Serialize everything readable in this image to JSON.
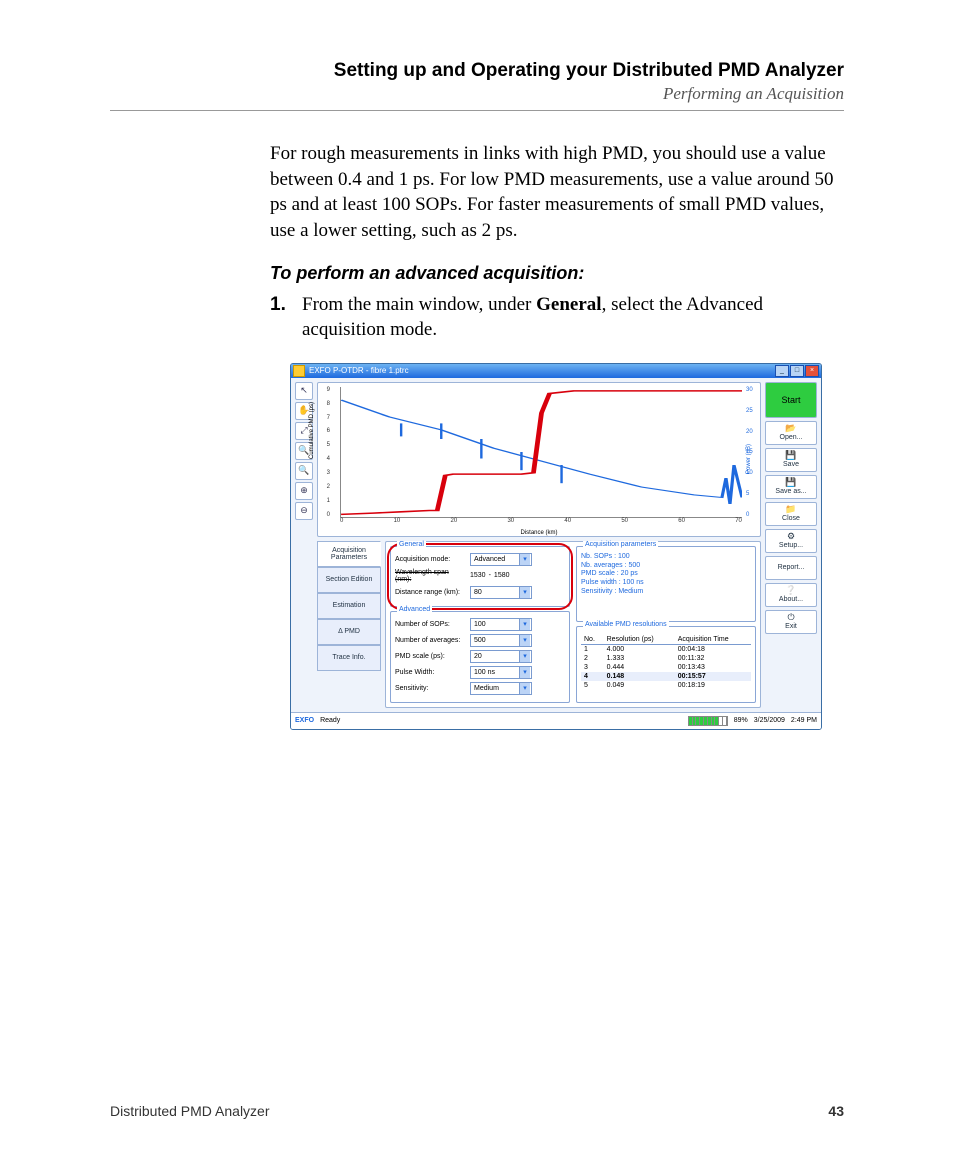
{
  "chapter": "Setting up and Operating your Distributed PMD Analyzer",
  "section": "Performing an Acquisition",
  "para1": "For rough measurements in links with high PMD, you should use a value between 0.4 and 1 ps. For low PMD measurements, use a value around 50 ps and at least 100 SOPs. For faster measurements of small PMD values, use a lower setting, such as 2 ps.",
  "task_head": "To perform an advanced acquisition:",
  "step1_num": "1.",
  "step1_a": "From the main window, under ",
  "step1_b": "General",
  "step1_c": ", select the Advanced acquisition mode.",
  "footer_left": "Distributed PMD Analyzer",
  "footer_right": "43",
  "app": {
    "title": "EXFO P-OTDR - fibre 1.ptrc",
    "tools": [
      "↖",
      "✋",
      "⤢",
      "🔍",
      "🔍",
      "⊕",
      "⊖"
    ],
    "right_buttons": {
      "start": "Start",
      "open": "Open...",
      "save": "Save",
      "saveas": "Save as...",
      "close": "Close",
      "setup": "Setup...",
      "report": "Report...",
      "about": "About...",
      "exit": "Exit"
    },
    "tabs": [
      "Acquisition Parameters",
      "Section Edition",
      "Estimation",
      "Δ PMD",
      "Trace Info."
    ],
    "general": {
      "legend": "General",
      "mode_label": "Acquisition mode:",
      "mode_value": "Advanced",
      "wave_label": "Wavelength span (nm):",
      "wave_from": "1530",
      "wave_to": "1580",
      "range_label": "Distance range (km):",
      "range_value": "80"
    },
    "advanced": {
      "legend": "Advanced",
      "sops_label": "Number of SOPs:",
      "sops_value": "100",
      "avg_label": "Number of averages:",
      "avg_value": "500",
      "scale_label": "PMD scale (ps):",
      "scale_value": "20",
      "pulse_label": "Pulse Width:",
      "pulse_value": "100 ns",
      "sens_label": "Sensitivity:",
      "sens_value": "Medium"
    },
    "acq_params": {
      "legend": "Acquisition parameters",
      "l1": "Nb. SOPs : 100",
      "l2": "Nb. averages : 500",
      "l3": "PMD scale : 20 ps",
      "l4": "Pulse width : 100 ns",
      "l5": "Sensitivity : Medium"
    },
    "resolutions": {
      "legend": "Available PMD resolutions",
      "headers": [
        "No.",
        "Resolution (ps)",
        "Acquisition Time"
      ],
      "rows": [
        {
          "n": "1",
          "r": "4.000",
          "t": "00:04:18"
        },
        {
          "n": "2",
          "r": "1.333",
          "t": "00:11:32"
        },
        {
          "n": "3",
          "r": "0.444",
          "t": "00:13:43"
        },
        {
          "n": "4",
          "r": "0.148",
          "t": "00:15:57",
          "sel": true
        },
        {
          "n": "5",
          "r": "0.049",
          "t": "00:18:19"
        }
      ]
    },
    "status": {
      "brand": "EXFO",
      "ready": "Ready",
      "batt": "89%",
      "date": "3/25/2009",
      "time": "2:49 PM"
    }
  },
  "chart_data": {
    "type": "line",
    "title": "",
    "xlabel": "Distance (km)",
    "ylabel": "Cumulative PMD (ps)",
    "ylabel2": "Power (dB)",
    "xlim": [
      0,
      78
    ],
    "xticks": [
      0,
      10,
      20,
      30,
      40,
      50,
      60,
      70
    ],
    "ylim": [
      0,
      9
    ],
    "yticks": [
      0,
      1,
      2,
      3,
      4,
      5,
      6,
      7,
      8,
      9
    ],
    "y2lim": [
      0,
      30
    ],
    "y2ticks": [
      0,
      5,
      10,
      15,
      20,
      25,
      30
    ],
    "series": [
      {
        "name": "Cumulative PMD",
        "axis": "y",
        "color": "#d8000c",
        "x": [
          0,
          5,
          10,
          15,
          18,
          20,
          22,
          28,
          35,
          38,
          40,
          41,
          45,
          78
        ],
        "y": [
          0.2,
          0.3,
          0.4,
          0.5,
          0.5,
          2.8,
          3.0,
          3.0,
          3.0,
          3.1,
          7.2,
          8.6,
          8.8,
          8.8
        ]
      },
      {
        "name": "Power",
        "axis": "y2",
        "color": "#1e69de",
        "x": [
          0,
          10,
          20,
          30,
          40,
          50,
          60,
          70,
          76,
          78
        ],
        "y": [
          27,
          23,
          20,
          16,
          13,
          10,
          7,
          5,
          4,
          4
        ]
      }
    ]
  }
}
